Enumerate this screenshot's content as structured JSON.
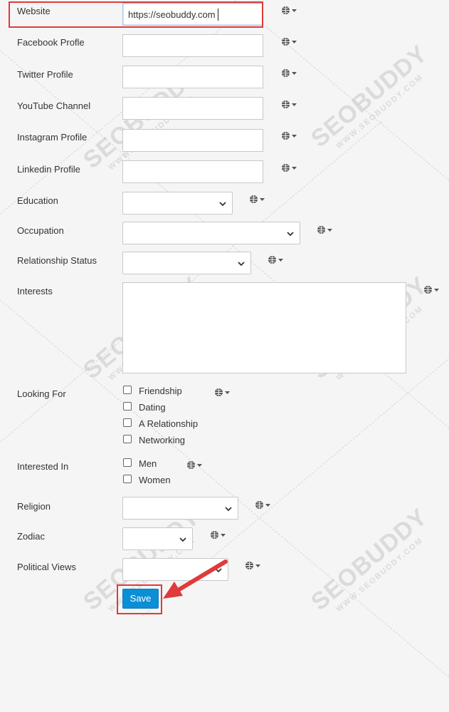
{
  "fields": {
    "website": {
      "label": "Website",
      "value": "https://seobuddy.com"
    },
    "facebook": {
      "label": "Facebook Profle",
      "value": ""
    },
    "twitter": {
      "label": "Twitter Profile",
      "value": ""
    },
    "youtube": {
      "label": "YouTube Channel",
      "value": ""
    },
    "instagram": {
      "label": "Instagram Profile",
      "value": ""
    },
    "linkedin": {
      "label": "Linkedin Profile",
      "value": ""
    },
    "education": {
      "label": "Education",
      "value": ""
    },
    "occupation": {
      "label": "Occupation",
      "value": ""
    },
    "relationship": {
      "label": "Relationship Status",
      "value": ""
    },
    "interests": {
      "label": "Interests",
      "value": ""
    },
    "looking_for": {
      "label": "Looking For",
      "options": [
        {
          "label": "Friendship",
          "checked": false
        },
        {
          "label": "Dating",
          "checked": false
        },
        {
          "label": "A Relationship",
          "checked": false
        },
        {
          "label": "Networking",
          "checked": false
        }
      ]
    },
    "interested_in": {
      "label": "Interested In",
      "options": [
        {
          "label": "Men",
          "checked": false
        },
        {
          "label": "Women",
          "checked": false
        }
      ]
    },
    "religion": {
      "label": "Religion",
      "value": ""
    },
    "zodiac": {
      "label": "Zodiac",
      "value": ""
    },
    "political": {
      "label": "Political Views",
      "value": ""
    }
  },
  "save_button": {
    "label": "Save"
  },
  "icons": {
    "privacy": "globe-icon",
    "dropdown": "chevron-down-icon"
  },
  "watermark": {
    "brand": "SEOBUDDY",
    "url": "WWW.SEOBUDDY.COM"
  },
  "colors": {
    "highlight": "#e03a3a",
    "button": "#0a8fd6"
  }
}
